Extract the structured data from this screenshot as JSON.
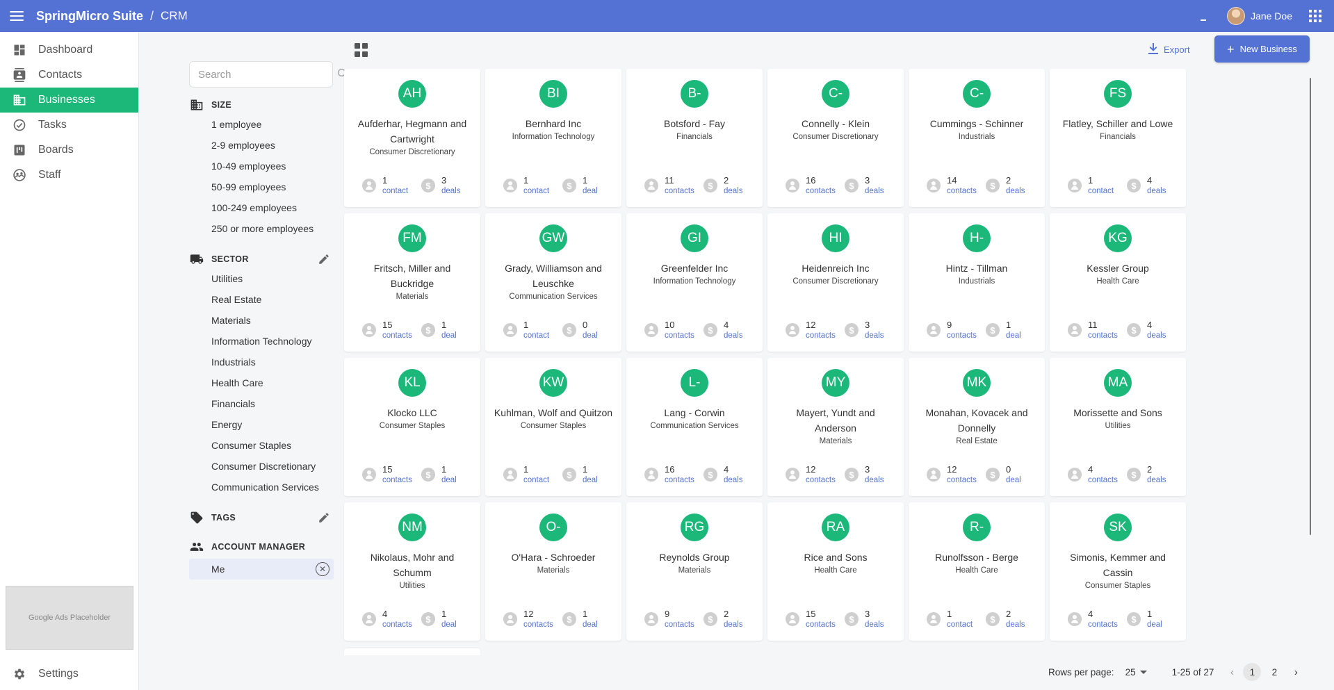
{
  "header": {
    "brand": "SpringMicro Suite",
    "separator": "/",
    "section": "CRM",
    "user_name": "Jane Doe"
  },
  "nav": {
    "items": [
      {
        "label": "Dashboard",
        "icon": "dashboard-icon"
      },
      {
        "label": "Contacts",
        "icon": "contacts-icon"
      },
      {
        "label": "Businesses",
        "icon": "businesses-icon",
        "active": true
      },
      {
        "label": "Tasks",
        "icon": "tasks-icon"
      },
      {
        "label": "Boards",
        "icon": "boards-icon"
      },
      {
        "label": "Staff",
        "icon": "staff-icon"
      }
    ],
    "ads_label": "Google Ads Placeholder",
    "settings_label": "Settings"
  },
  "filters": {
    "search_placeholder": "Search",
    "size": {
      "title": "SIZE",
      "options": [
        "1 employee",
        "2-9 employees",
        "10-49 employees",
        "50-99 employees",
        "100-249 employees",
        "250 or more employees"
      ]
    },
    "sector": {
      "title": "SECTOR",
      "options": [
        "Utilities",
        "Real Estate",
        "Materials",
        "Information Technology",
        "Industrials",
        "Health Care",
        "Financials",
        "Energy",
        "Consumer Staples",
        "Consumer Discretionary",
        "Communication Services"
      ]
    },
    "tags": {
      "title": "TAGS"
    },
    "account_manager": {
      "title": "ACCOUNT MANAGER",
      "selected": "Me"
    }
  },
  "toolbar": {
    "export_label": "Export",
    "new_label": "New Business"
  },
  "businesses": [
    {
      "initials": "AH",
      "name": "Aufderhar, Hegmann and Cartwright",
      "sector": "Consumer Discretionary",
      "contacts": "1",
      "contacts_label": "contact",
      "deals": "3",
      "deals_label": "deals"
    },
    {
      "initials": "BI",
      "name": "Bernhard Inc",
      "sector": "Information Technology",
      "contacts": "1",
      "contacts_label": "contact",
      "deals": "1",
      "deals_label": "deal"
    },
    {
      "initials": "B-",
      "name": "Botsford - Fay",
      "sector": "Financials",
      "contacts": "11",
      "contacts_label": "contacts",
      "deals": "2",
      "deals_label": "deals"
    },
    {
      "initials": "C-",
      "name": "Connelly - Klein",
      "sector": "Consumer Discretionary",
      "contacts": "16",
      "contacts_label": "contacts",
      "deals": "3",
      "deals_label": "deals"
    },
    {
      "initials": "C-",
      "name": "Cummings - Schinner",
      "sector": "Industrials",
      "contacts": "14",
      "contacts_label": "contacts",
      "deals": "2",
      "deals_label": "deals"
    },
    {
      "initials": "FS",
      "name": "Flatley, Schiller and Lowe",
      "sector": "Financials",
      "contacts": "1",
      "contacts_label": "contact",
      "deals": "4",
      "deals_label": "deals"
    },
    {
      "initials": "FM",
      "name": "Fritsch, Miller and Buckridge",
      "sector": "Materials",
      "contacts": "15",
      "contacts_label": "contacts",
      "deals": "1",
      "deals_label": "deal"
    },
    {
      "initials": "GW",
      "name": "Grady, Williamson and Leuschke",
      "sector": "Communication Services",
      "contacts": "1",
      "contacts_label": "contact",
      "deals": "0",
      "deals_label": "deal"
    },
    {
      "initials": "GI",
      "name": "Greenfelder Inc",
      "sector": "Information Technology",
      "contacts": "10",
      "contacts_label": "contacts",
      "deals": "4",
      "deals_label": "deals"
    },
    {
      "initials": "HI",
      "name": "Heidenreich Inc",
      "sector": "Consumer Discretionary",
      "contacts": "12",
      "contacts_label": "contacts",
      "deals": "3",
      "deals_label": "deals"
    },
    {
      "initials": "H-",
      "name": "Hintz - Tillman",
      "sector": "Industrials",
      "contacts": "9",
      "contacts_label": "contacts",
      "deals": "1",
      "deals_label": "deal"
    },
    {
      "initials": "KG",
      "name": "Kessler Group",
      "sector": "Health Care",
      "contacts": "11",
      "contacts_label": "contacts",
      "deals": "4",
      "deals_label": "deals"
    },
    {
      "initials": "KL",
      "name": "Klocko LLC",
      "sector": "Consumer Staples",
      "contacts": "15",
      "contacts_label": "contacts",
      "deals": "1",
      "deals_label": "deal"
    },
    {
      "initials": "KW",
      "name": "Kuhlman, Wolf and Quitzon",
      "sector": "Consumer Staples",
      "contacts": "1",
      "contacts_label": "contact",
      "deals": "1",
      "deals_label": "deal"
    },
    {
      "initials": "L-",
      "name": "Lang - Corwin",
      "sector": "Communication Services",
      "contacts": "16",
      "contacts_label": "contacts",
      "deals": "4",
      "deals_label": "deals"
    },
    {
      "initials": "MY",
      "name": "Mayert, Yundt and Anderson",
      "sector": "Materials",
      "contacts": "12",
      "contacts_label": "contacts",
      "deals": "3",
      "deals_label": "deals"
    },
    {
      "initials": "MK",
      "name": "Monahan, Kovacek and Donnelly",
      "sector": "Real Estate",
      "contacts": "12",
      "contacts_label": "contacts",
      "deals": "0",
      "deals_label": "deal"
    },
    {
      "initials": "MA",
      "name": "Morissette and Sons",
      "sector": "Utilities",
      "contacts": "4",
      "contacts_label": "contacts",
      "deals": "2",
      "deals_label": "deals"
    },
    {
      "initials": "NM",
      "name": "Nikolaus, Mohr and Schumm",
      "sector": "Utilities",
      "contacts": "4",
      "contacts_label": "contacts",
      "deals": "1",
      "deals_label": "deal"
    },
    {
      "initials": "O-",
      "name": "O'Hara - Schroeder",
      "sector": "Materials",
      "contacts": "12",
      "contacts_label": "contacts",
      "deals": "1",
      "deals_label": "deal"
    },
    {
      "initials": "RG",
      "name": "Reynolds Group",
      "sector": "Materials",
      "contacts": "9",
      "contacts_label": "contacts",
      "deals": "2",
      "deals_label": "deals"
    },
    {
      "initials": "RA",
      "name": "Rice and Sons",
      "sector": "Health Care",
      "contacts": "15",
      "contacts_label": "contacts",
      "deals": "3",
      "deals_label": "deals"
    },
    {
      "initials": "R-",
      "name": "Runolfsson - Berge",
      "sector": "Health Care",
      "contacts": "1",
      "contacts_label": "contact",
      "deals": "2",
      "deals_label": "deals"
    },
    {
      "initials": "SK",
      "name": "Simonis, Kemmer and Cassin",
      "sector": "Consumer Staples",
      "contacts": "4",
      "contacts_label": "contacts",
      "deals": "1",
      "deals_label": "deal"
    }
  ],
  "pagination": {
    "rows_label": "Rows per page:",
    "rows_value": "25",
    "range": "1-25 of 27",
    "pages": [
      "1",
      "2"
    ],
    "current": "1",
    "prev_glyph": "‹",
    "next_glyph": "›"
  },
  "colors": {
    "header": "#5472d3",
    "accent": "#1bb87a"
  }
}
